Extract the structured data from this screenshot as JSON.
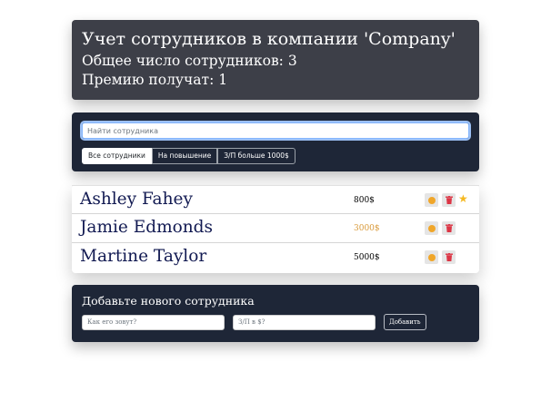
{
  "header": {
    "title": "Учет сотрудников в компании 'Company'",
    "total": "Общее число сотрудников: 3",
    "bonus": "Премию получат: 1"
  },
  "search": {
    "placeholder": "Найти сотрудника"
  },
  "filters": [
    {
      "label": "Все сотрудники",
      "active": true
    },
    {
      "label": "На повышение",
      "active": false
    },
    {
      "label": "З/П больше 1000$",
      "active": false
    }
  ],
  "employees": [
    {
      "name": "Ashley Fahey",
      "salary": "800$",
      "increase": false,
      "starred": true
    },
    {
      "name": "Jamie Edmonds",
      "salary": "3000$",
      "increase": true,
      "starred": false
    },
    {
      "name": "Martine Taylor",
      "salary": "5000$",
      "increase": false,
      "starred": false
    }
  ],
  "add_form": {
    "title": "Добавьте нового сотрудника",
    "name_placeholder": "Как его зовут?",
    "salary_placeholder": "З/П в $?",
    "submit_label": "Добавить"
  },
  "colors": {
    "accent_increase": "#d99a3a",
    "star": "#f5b820",
    "trash": "#dc3545",
    "cookie": "#f0a62a"
  },
  "icons": {
    "cookie": "cookie-icon",
    "trash": "trash-icon",
    "star": "star-icon"
  }
}
